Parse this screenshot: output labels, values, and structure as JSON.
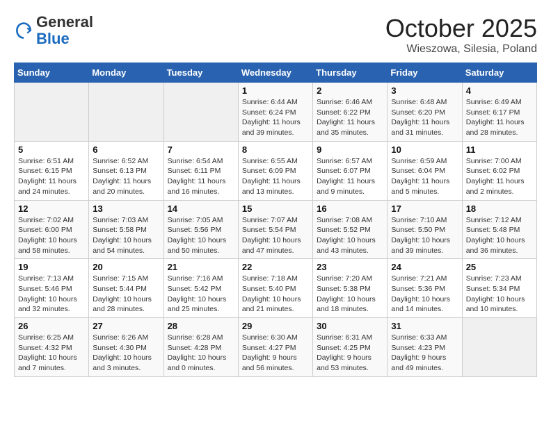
{
  "header": {
    "logo_general": "General",
    "logo_blue": "Blue",
    "month": "October 2025",
    "location": "Wieszowa, Silesia, Poland"
  },
  "days_of_week": [
    "Sunday",
    "Monday",
    "Tuesday",
    "Wednesday",
    "Thursday",
    "Friday",
    "Saturday"
  ],
  "weeks": [
    [
      {
        "day": "",
        "info": ""
      },
      {
        "day": "",
        "info": ""
      },
      {
        "day": "",
        "info": ""
      },
      {
        "day": "1",
        "info": "Sunrise: 6:44 AM\nSunset: 6:24 PM\nDaylight: 11 hours\nand 39 minutes."
      },
      {
        "day": "2",
        "info": "Sunrise: 6:46 AM\nSunset: 6:22 PM\nDaylight: 11 hours\nand 35 minutes."
      },
      {
        "day": "3",
        "info": "Sunrise: 6:48 AM\nSunset: 6:20 PM\nDaylight: 11 hours\nand 31 minutes."
      },
      {
        "day": "4",
        "info": "Sunrise: 6:49 AM\nSunset: 6:17 PM\nDaylight: 11 hours\nand 28 minutes."
      }
    ],
    [
      {
        "day": "5",
        "info": "Sunrise: 6:51 AM\nSunset: 6:15 PM\nDaylight: 11 hours\nand 24 minutes."
      },
      {
        "day": "6",
        "info": "Sunrise: 6:52 AM\nSunset: 6:13 PM\nDaylight: 11 hours\nand 20 minutes."
      },
      {
        "day": "7",
        "info": "Sunrise: 6:54 AM\nSunset: 6:11 PM\nDaylight: 11 hours\nand 16 minutes."
      },
      {
        "day": "8",
        "info": "Sunrise: 6:55 AM\nSunset: 6:09 PM\nDaylight: 11 hours\nand 13 minutes."
      },
      {
        "day": "9",
        "info": "Sunrise: 6:57 AM\nSunset: 6:07 PM\nDaylight: 11 hours\nand 9 minutes."
      },
      {
        "day": "10",
        "info": "Sunrise: 6:59 AM\nSunset: 6:04 PM\nDaylight: 11 hours\nand 5 minutes."
      },
      {
        "day": "11",
        "info": "Sunrise: 7:00 AM\nSunset: 6:02 PM\nDaylight: 11 hours\nand 2 minutes."
      }
    ],
    [
      {
        "day": "12",
        "info": "Sunrise: 7:02 AM\nSunset: 6:00 PM\nDaylight: 10 hours\nand 58 minutes."
      },
      {
        "day": "13",
        "info": "Sunrise: 7:03 AM\nSunset: 5:58 PM\nDaylight: 10 hours\nand 54 minutes."
      },
      {
        "day": "14",
        "info": "Sunrise: 7:05 AM\nSunset: 5:56 PM\nDaylight: 10 hours\nand 50 minutes."
      },
      {
        "day": "15",
        "info": "Sunrise: 7:07 AM\nSunset: 5:54 PM\nDaylight: 10 hours\nand 47 minutes."
      },
      {
        "day": "16",
        "info": "Sunrise: 7:08 AM\nSunset: 5:52 PM\nDaylight: 10 hours\nand 43 minutes."
      },
      {
        "day": "17",
        "info": "Sunrise: 7:10 AM\nSunset: 5:50 PM\nDaylight: 10 hours\nand 39 minutes."
      },
      {
        "day": "18",
        "info": "Sunrise: 7:12 AM\nSunset: 5:48 PM\nDaylight: 10 hours\nand 36 minutes."
      }
    ],
    [
      {
        "day": "19",
        "info": "Sunrise: 7:13 AM\nSunset: 5:46 PM\nDaylight: 10 hours\nand 32 minutes."
      },
      {
        "day": "20",
        "info": "Sunrise: 7:15 AM\nSunset: 5:44 PM\nDaylight: 10 hours\nand 28 minutes."
      },
      {
        "day": "21",
        "info": "Sunrise: 7:16 AM\nSunset: 5:42 PM\nDaylight: 10 hours\nand 25 minutes."
      },
      {
        "day": "22",
        "info": "Sunrise: 7:18 AM\nSunset: 5:40 PM\nDaylight: 10 hours\nand 21 minutes."
      },
      {
        "day": "23",
        "info": "Sunrise: 7:20 AM\nSunset: 5:38 PM\nDaylight: 10 hours\nand 18 minutes."
      },
      {
        "day": "24",
        "info": "Sunrise: 7:21 AM\nSunset: 5:36 PM\nDaylight: 10 hours\nand 14 minutes."
      },
      {
        "day": "25",
        "info": "Sunrise: 7:23 AM\nSunset: 5:34 PM\nDaylight: 10 hours\nand 10 minutes."
      }
    ],
    [
      {
        "day": "26",
        "info": "Sunrise: 6:25 AM\nSunset: 4:32 PM\nDaylight: 10 hours\nand 7 minutes."
      },
      {
        "day": "27",
        "info": "Sunrise: 6:26 AM\nSunset: 4:30 PM\nDaylight: 10 hours\nand 3 minutes."
      },
      {
        "day": "28",
        "info": "Sunrise: 6:28 AM\nSunset: 4:28 PM\nDaylight: 10 hours\nand 0 minutes."
      },
      {
        "day": "29",
        "info": "Sunrise: 6:30 AM\nSunset: 4:27 PM\nDaylight: 9 hours\nand 56 minutes."
      },
      {
        "day": "30",
        "info": "Sunrise: 6:31 AM\nSunset: 4:25 PM\nDaylight: 9 hours\nand 53 minutes."
      },
      {
        "day": "31",
        "info": "Sunrise: 6:33 AM\nSunset: 4:23 PM\nDaylight: 9 hours\nand 49 minutes."
      },
      {
        "day": "",
        "info": ""
      }
    ]
  ]
}
